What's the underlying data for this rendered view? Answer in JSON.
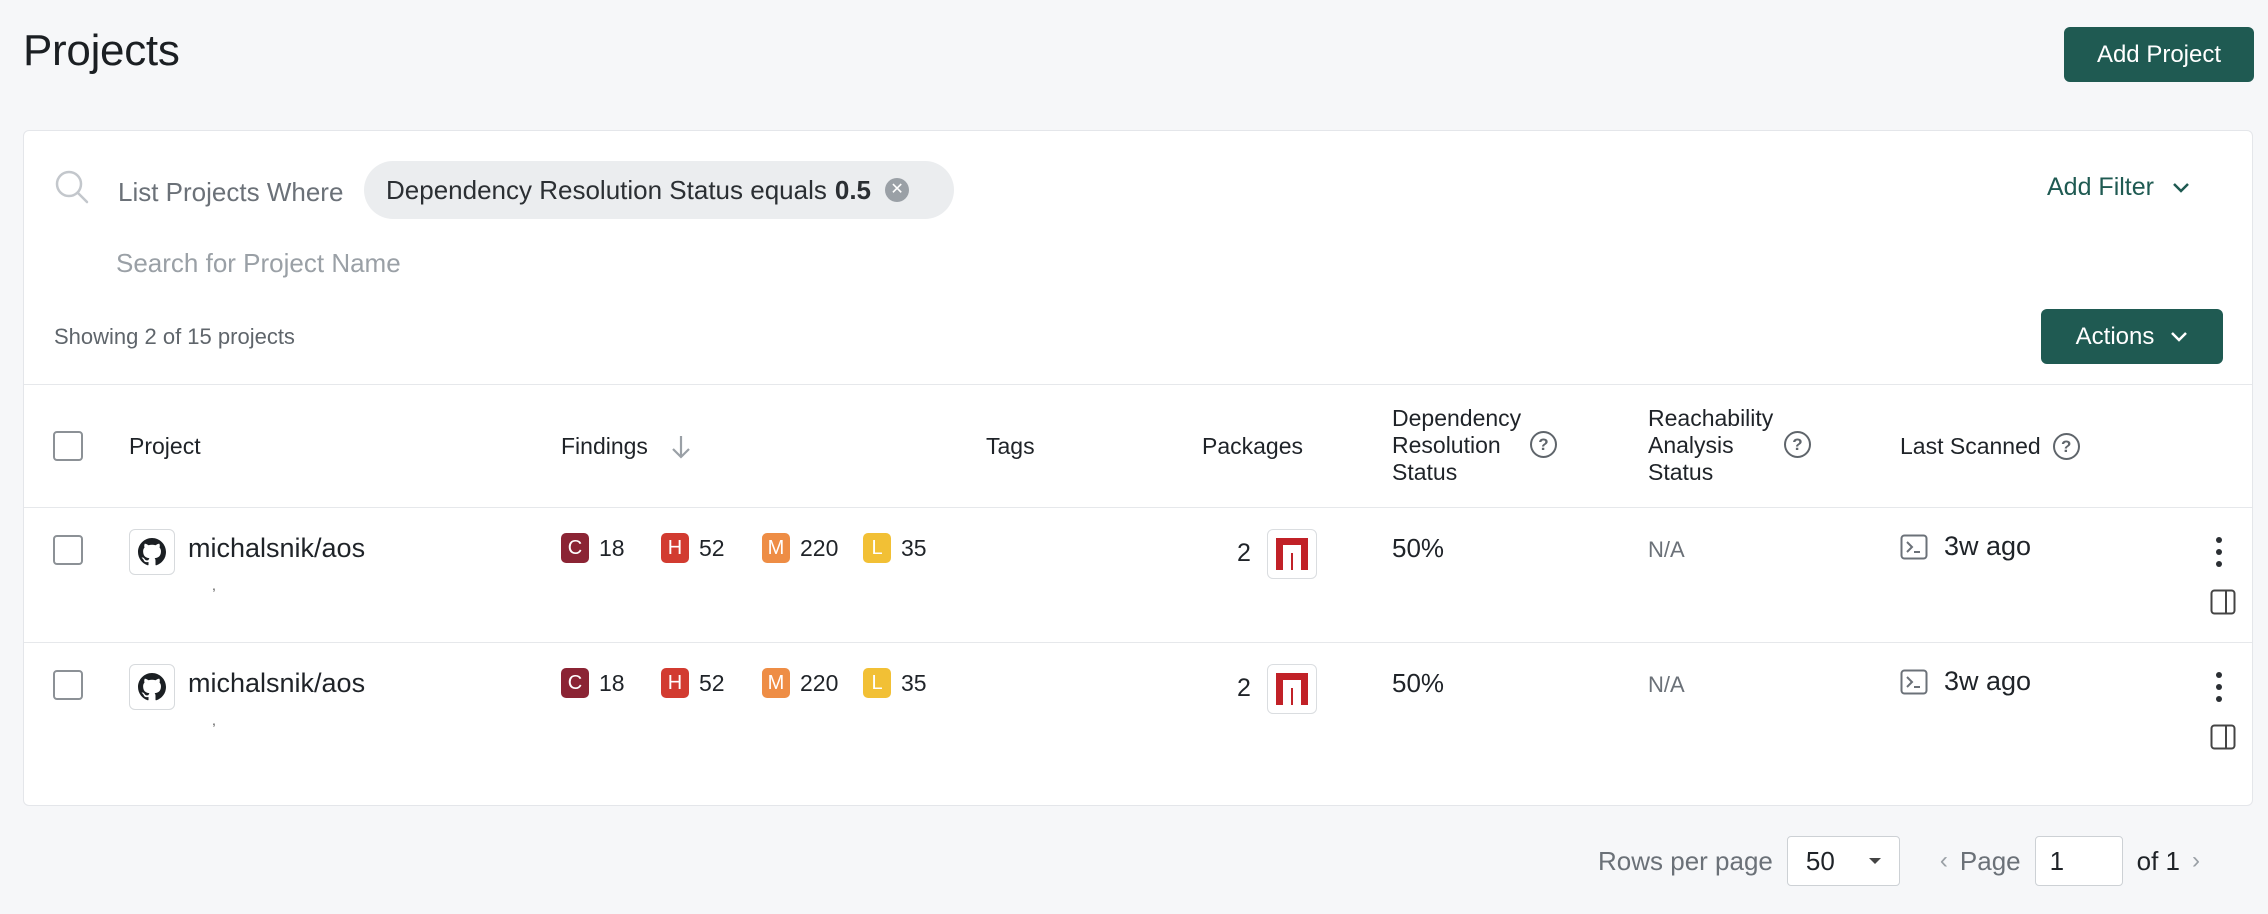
{
  "page": {
    "title": "Projects"
  },
  "header": {
    "add_project_label": "Add Project"
  },
  "filter": {
    "prefix": "List Projects Where",
    "chip_label": "Dependency Resolution Status equals",
    "chip_value": "0.5",
    "add_filter_label": "Add Filter",
    "search_placeholder": "Search for Project Name"
  },
  "toolbar": {
    "showing_text": "Showing 2 of 15 projects",
    "actions_label": "Actions"
  },
  "table": {
    "headers": {
      "project": "Project",
      "findings": "Findings",
      "tags": "Tags",
      "packages": "Packages",
      "dep_l1": "Dependency",
      "dep_l2": "Resolution",
      "dep_l3": "Status",
      "reach_l1": "Reachability",
      "reach_l2": "Analysis",
      "reach_l3": "Status",
      "last_scanned": "Last Scanned"
    },
    "rows": [
      {
        "name": "michalsnik/aos",
        "critical": "18",
        "high": "52",
        "medium": "220",
        "low": "35",
        "packages": "2",
        "dep_status": "50%",
        "reachability": "N/A",
        "last_scanned": "3w ago"
      },
      {
        "name": "michalsnik/aos",
        "critical": "18",
        "high": "52",
        "medium": "220",
        "low": "35",
        "packages": "2",
        "dep_status": "50%",
        "reachability": "N/A",
        "last_scanned": "3w ago"
      }
    ],
    "severity_letters": {
      "c": "C",
      "h": "H",
      "m": "M",
      "l": "L"
    },
    "severity_colors": {
      "critical": "#8b2434",
      "high": "#d23b30",
      "medium": "#ee8d45",
      "low": "#f2c035"
    }
  },
  "pagination": {
    "rows_per_page_label": "Rows per page",
    "rows_per_page_value": "50",
    "page_label": "Page",
    "page_value": "1",
    "of_label": "of 1"
  },
  "colors": {
    "accent": "#1f5a52",
    "background": "#f6f7f9"
  }
}
